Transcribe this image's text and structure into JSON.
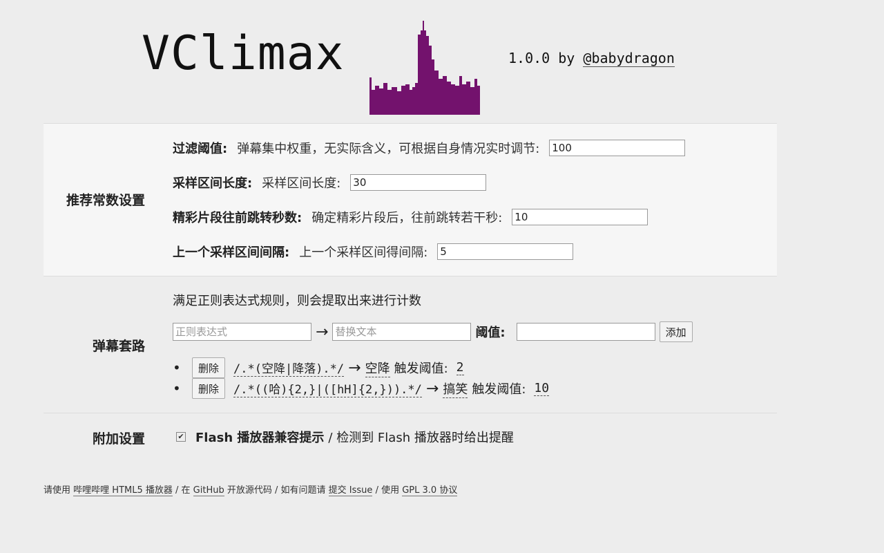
{
  "header": {
    "title": "VClimax",
    "version": "1.0.0",
    "by": "by",
    "author": "@babydragon",
    "logo_color": "#73126d"
  },
  "constants": {
    "section_label": "推荐常数设置",
    "filter": {
      "label": "过滤阈值:",
      "desc": "弹幕集中权重，无实际含义，可根据自身情况实时调节:",
      "value": "100"
    },
    "sample_len": {
      "label": "采样区间长度:",
      "desc": "采样区间长度:",
      "value": "30"
    },
    "jump_back": {
      "label": "精彩片段往前跳转秒数:",
      "desc": "确定精彩片段后，往前跳转若干秒:",
      "value": "10"
    },
    "prev_interval": {
      "label": "上一个采样区间间隔:",
      "desc": "上一个采样区间得间隔:",
      "value": "5"
    }
  },
  "danmaku": {
    "section_label": "弹幕套路",
    "intro": "满足正则表达式规则，则会提取出来进行计数",
    "regex_placeholder": "正则表达式",
    "replace_placeholder": "替换文本",
    "arrow": "→",
    "threshold_label": "阈值:",
    "add_label": "添加",
    "rules": [
      {
        "delete_label": "删除",
        "pattern": "/.*(空降|降落).*/",
        "replacement": "空降",
        "threshold_label": "触发阈值:",
        "threshold": "2"
      },
      {
        "delete_label": "删除",
        "pattern": "/.*((哈){2,}|([hH]{2,})).*/",
        "replacement": "搞笑",
        "threshold_label": "触发阈值:",
        "threshold": "10"
      }
    ]
  },
  "extra": {
    "section_label": "附加设置",
    "flash_title": "Flash 播放器兼容提示",
    "flash_desc": "/ 检测到 Flash 播放器时给出提醒",
    "flash_checked": true
  },
  "footer": {
    "t1": "请使用",
    "l1": "哔哩哔哩 HTML5 播放器",
    "t2": "/ 在",
    "l2": "GitHub",
    "t3": "开放源代码 / 如有问题请",
    "l3": "提交 Issue",
    "t4": "/ 使用",
    "l4": "GPL 3.0 协议"
  }
}
